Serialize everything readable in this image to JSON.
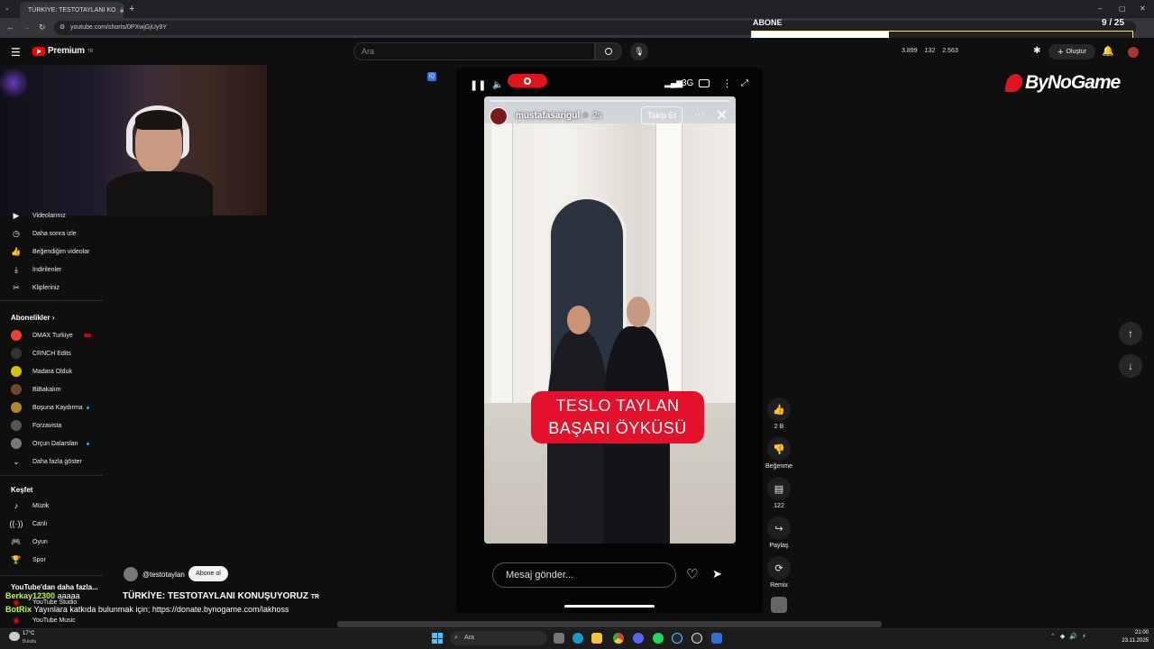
{
  "browser": {
    "tab_title": "TÜRKİYE: TESTOTAYLANI KO",
    "new_tab": "+",
    "url": "youtube.com/shorts/0PXwjGjUy9Y",
    "window_controls": [
      "–",
      "▢",
      "✕"
    ]
  },
  "overlay": {
    "subs_label": "ABONE",
    "subs_count": "9 / 25",
    "brand": "ByNoGame"
  },
  "header": {
    "logo_text": "Premium",
    "logo_sup": "TR",
    "search_placeholder": "Ara",
    "stats": [
      "3.899",
      "132",
      "2.563"
    ],
    "create_label": "Oluştur"
  },
  "sidebar": {
    "top_items": [
      {
        "label": "Videolarınız",
        "icon": "video-icon"
      },
      {
        "label": "Daha sonra izle",
        "icon": "clock-icon"
      },
      {
        "label": "Beğendiğim videolar",
        "icon": "thumb-up-icon"
      },
      {
        "label": "İndirilenler",
        "icon": "download-icon"
      },
      {
        "label": "Klipleriniz",
        "icon": "scissors-icon"
      }
    ],
    "subs_heading": "Abonelikler",
    "channels": [
      {
        "label": "DMAX Turkiye",
        "color": "#e8452f"
      },
      {
        "label": "CRNCH Edits",
        "color": "#333333"
      },
      {
        "label": "Madara Olduk",
        "color": "#d9c100"
      },
      {
        "label": "BiBakalım",
        "color": "#6b4a2b"
      },
      {
        "label": "Boşuna Kaydırma",
        "color": "#b38a2a"
      },
      {
        "label": "Forzavista",
        "color": "#555555"
      },
      {
        "label": "Orçun Dalarslan",
        "color": "#777777"
      }
    ],
    "more_label": "Daha fazla göster",
    "explore_heading": "Keşfet",
    "explore_items": [
      {
        "label": "Müzik",
        "icon": "music-icon"
      },
      {
        "label": "Canlı",
        "icon": "live-icon"
      },
      {
        "label": "Oyun",
        "icon": "gamepad-icon"
      },
      {
        "label": "Spor",
        "icon": "trophy-icon"
      }
    ],
    "more_from_yt": "YouTube'dan daha fazla...",
    "yt_apps": [
      "YouTube Studio",
      "YouTube Music"
    ]
  },
  "shorts": {
    "network": "3G",
    "story_user": "mustafasarigul_",
    "story_time": "2s",
    "follow_label": "Takip Et",
    "caption_line1": "TESLO TAYLAN",
    "caption_line2": "BAŞARI ÖYKÜSÜ",
    "message_placeholder": "Mesaj gönder...",
    "channel_handle": "@testotaylan",
    "subscribe_label": "Abone ol",
    "video_title": "TÜRKİYE: TESTOTAYLANI KONUŞUYORUZ",
    "title_suffix": "TR"
  },
  "actions": {
    "likes": "2 B",
    "dislike": "Beğenme",
    "comments": "122",
    "share": "Paylaş",
    "remix": "Remix"
  },
  "chat": [
    {
      "user": "Berkay12300",
      "text": "aaaaa",
      "color": "#b6ff3b"
    },
    {
      "user": "BotRix",
      "text": "Yayınlara katkıda bulunmak için; https://donate.bynogame.com/lakhoss",
      "color": "#b6ff3b"
    }
  ],
  "taskbar": {
    "weather_temp": "17°C",
    "weather_desc": "Bulutlu",
    "search": "Ara",
    "time": "21:00",
    "date": "23.11.2025"
  }
}
